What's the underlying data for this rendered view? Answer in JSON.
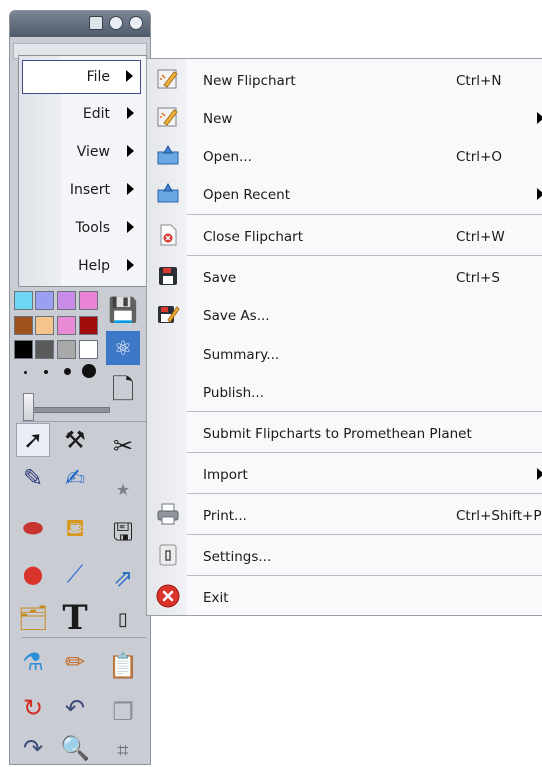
{
  "colors": {
    "menu_highlight_border": "#3f4a8c",
    "toolbox_bg": "#c9ccd3",
    "swatches": [
      "#6ed6f2",
      "#9b9ff2",
      "#c88be7",
      "#ea83d5",
      "#a0521c",
      "#f5c48d",
      "#e98ad6",
      "#a00d0d",
      "#000000",
      "#5a5a5a",
      "#a8a8a8",
      "#ffffff"
    ]
  },
  "menu": {
    "items": [
      {
        "label": "File",
        "active": true
      },
      {
        "label": "Edit"
      },
      {
        "label": "View"
      },
      {
        "label": "Insert"
      },
      {
        "label": "Tools"
      },
      {
        "label": "Help"
      }
    ]
  },
  "file_menu": {
    "items": [
      {
        "label": "New Flipchart",
        "shortcut": "Ctrl+N",
        "icon": "new-flipchart-icon"
      },
      {
        "label": "New",
        "submenu": true,
        "icon": "new-icon"
      },
      {
        "label": "Open...",
        "shortcut": "Ctrl+O",
        "icon": "open-folder-icon"
      },
      {
        "label": "Open Recent",
        "submenu": true,
        "icon": "open-recent-icon"
      },
      {
        "label": "Close Flipchart",
        "shortcut": "Ctrl+W",
        "icon": "close-flipchart-icon"
      },
      {
        "label": "Save",
        "shortcut": "Ctrl+S",
        "icon": "save-icon"
      },
      {
        "label": "Save As...",
        "icon": "save-as-icon"
      },
      {
        "label": "Summary..."
      },
      {
        "label": "Publish..."
      },
      {
        "label": "Submit Flipcharts to Promethean Planet"
      },
      {
        "label": "Import",
        "submenu": true
      },
      {
        "label": "Print...",
        "shortcut": "Ctrl+Shift+P",
        "icon": "printer-icon"
      },
      {
        "label": "Settings...",
        "icon": "settings-icon"
      },
      {
        "label": "Exit",
        "icon": "exit-icon"
      }
    ]
  },
  "toolbox": {
    "tools": [
      "pointer-icon",
      "main-tools-icon",
      "scissors-icon",
      "pen-icon",
      "highlighter-icon",
      "star-shape-icon",
      "eraser-icon",
      "fill-icon",
      "save-icon",
      "shapes-icon",
      "connector-icon",
      "export-icon",
      "clipboard-icon",
      "text-icon",
      "settings-icon",
      "reveal-icon",
      "magic-ink-icon",
      "paste-icon",
      "reset-page-icon",
      "undo-icon",
      "layers-icon",
      "redo-icon",
      "zoom-icon",
      "grid-icon"
    ]
  }
}
